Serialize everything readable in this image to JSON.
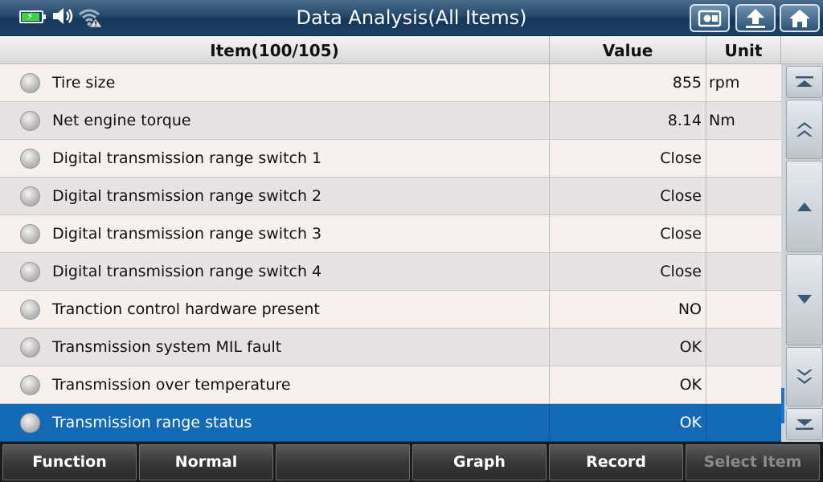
{
  "header": {
    "title": "Data Analysis(All Items)",
    "icons": [
      "battery-icon",
      "speaker-icon",
      "wifi-warning-icon"
    ],
    "buttons": [
      "screenshot-icon",
      "back-arrow-icon",
      "home-icon"
    ]
  },
  "table": {
    "columns": {
      "item": "Item(100/105)",
      "value": "Value",
      "unit": "Unit"
    },
    "rows": [
      {
        "name": "Tire size",
        "value": "855",
        "unit": "rpm"
      },
      {
        "name": "Net engine torque",
        "value": "8.14",
        "unit": "Nm"
      },
      {
        "name": "Digital transmission range switch 1",
        "value": "Close",
        "unit": ""
      },
      {
        "name": "Digital transmission range switch 2",
        "value": "Close",
        "unit": ""
      },
      {
        "name": "Digital transmission range switch 3",
        "value": "Close",
        "unit": ""
      },
      {
        "name": "Digital transmission range switch 4",
        "value": "Close",
        "unit": ""
      },
      {
        "name": "Tranction control hardware present",
        "value": "NO",
        "unit": ""
      },
      {
        "name": "Transmission system MIL fault",
        "value": "OK",
        "unit": ""
      },
      {
        "name": "Transmission over temperature",
        "value": "OK",
        "unit": ""
      },
      {
        "name": "Transmission range status",
        "value": "OK",
        "unit": ""
      }
    ],
    "selected_row": 9
  },
  "scroll": {
    "buttons": [
      "scroll-top-icon",
      "page-up-icon",
      "line-up-icon",
      "line-down-icon",
      "page-down-icon",
      "scroll-bottom-icon"
    ]
  },
  "footer": {
    "buttons": [
      "Function",
      "Normal",
      "",
      "Graph",
      "Record",
      "Select Item"
    ]
  },
  "colors": {
    "selected_row": "#1469b5",
    "title_bar": "#24486a"
  }
}
